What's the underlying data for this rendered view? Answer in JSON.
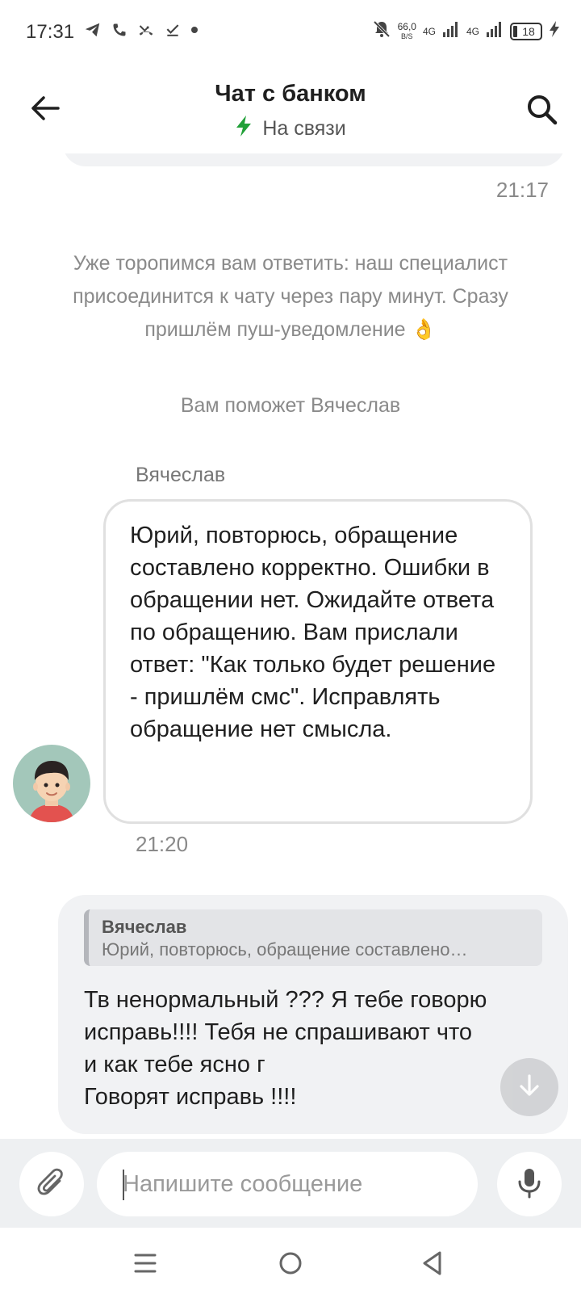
{
  "status_bar": {
    "time": "17:31",
    "speed_value": "66,0",
    "speed_unit": "B/S",
    "net1": "4G",
    "net2": "4G",
    "battery": "18"
  },
  "header": {
    "title": "Чат с банком",
    "status": "На связи",
    "status_color": "#21a038",
    "back_icon": "arrow-left-icon",
    "search_icon": "search-icon"
  },
  "chat": {
    "prev_time": "21:17",
    "system_message": "Уже торопимся вам ответить: наш специалист присоединится к чату через пару минут. Сразу пришлём пуш-уведомление 👌",
    "helper_note": "Вам поможет Вячеслав",
    "agent_name": "Вячеслав",
    "incoming": {
      "text": "Юрий, повторюсь, обращение составлено корректно. Ошибки в обращении нет. Ожидайте ответа по обращению. Вам прислали ответ: \"Как только будет решение - пришлём смс\". Исправлять обращение нет смысла.",
      "time": "21:20"
    },
    "outgoing": {
      "quote_author": "Вячеслав",
      "quote_text": "Юрий, повторюсь, обращение составлено…",
      "text_line1": "Тв ненормальный ??? Я тебе говорю",
      "text_line2": "исправь!!!! Тебя не спрашивают что",
      "text_line3": "и как тебе ясно г",
      "text_line4": "Говорят исправь !!!!"
    }
  },
  "composer": {
    "placeholder": "Напишите сообщение",
    "attach_icon": "paperclip-icon",
    "mic_icon": "microphone-icon"
  },
  "nav_bar": {
    "menu_icon": "menu-icon",
    "home_icon": "home-circle-icon",
    "back_icon": "triangle-back-icon"
  }
}
